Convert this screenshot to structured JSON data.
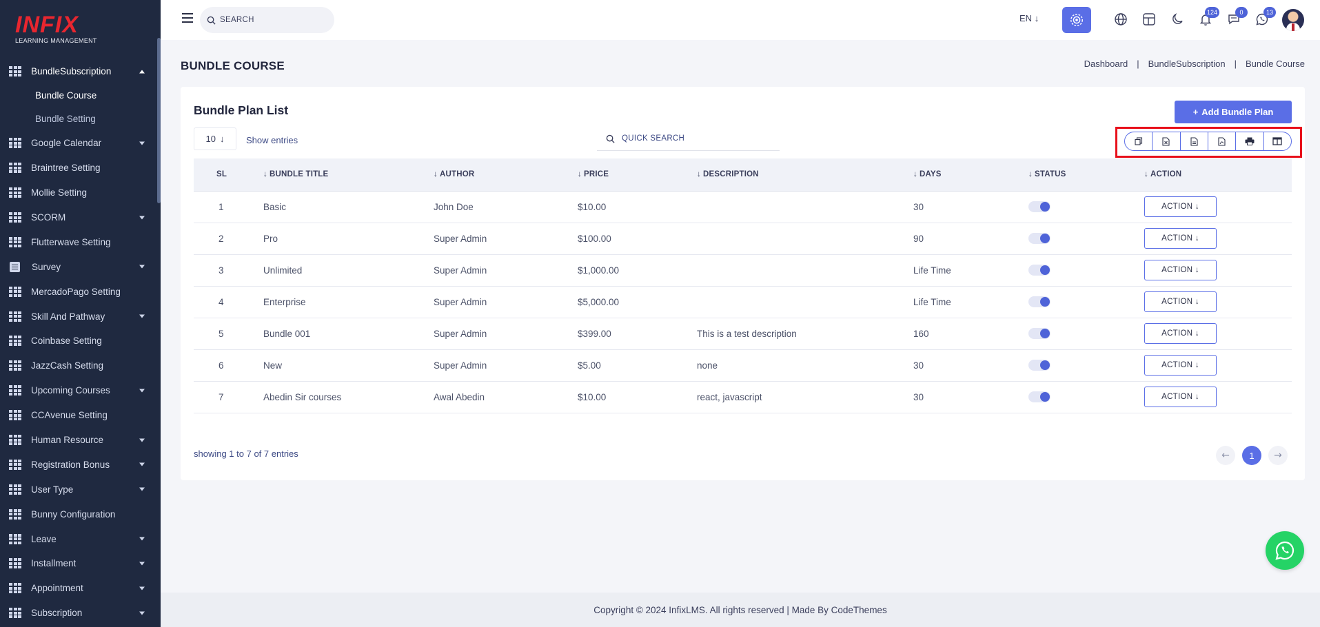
{
  "sidebar": {
    "logo_text": "INFIX",
    "logo_sub": "LEARNING MANAGEMENT",
    "active_group": "BundleSubscription",
    "sub_items": [
      {
        "label": "Bundle Course"
      },
      {
        "label": "Bundle Setting"
      }
    ],
    "items": [
      {
        "label": "Google Calendar",
        "expandable": true
      },
      {
        "label": "Braintree Setting",
        "expandable": false
      },
      {
        "label": "Mollie Setting",
        "expandable": false
      },
      {
        "label": "SCORM",
        "expandable": true
      },
      {
        "label": "Flutterwave Setting",
        "expandable": false
      },
      {
        "label": "Survey",
        "expandable": true
      },
      {
        "label": "MercadoPago Setting",
        "expandable": false
      },
      {
        "label": "Skill And Pathway",
        "expandable": true
      },
      {
        "label": "Coinbase Setting",
        "expandable": false
      },
      {
        "label": "JazzCash Setting",
        "expandable": false
      },
      {
        "label": "Upcoming Courses",
        "expandable": true
      },
      {
        "label": "CCAvenue Setting",
        "expandable": false
      },
      {
        "label": "Human Resource",
        "expandable": true
      },
      {
        "label": "Registration Bonus",
        "expandable": true
      },
      {
        "label": "User Type",
        "expandable": true
      },
      {
        "label": "Bunny Configuration",
        "expandable": false
      },
      {
        "label": "Leave",
        "expandable": true
      },
      {
        "label": "Installment",
        "expandable": true
      },
      {
        "label": "Appointment",
        "expandable": true
      },
      {
        "label": "Subscription",
        "expandable": true
      }
    ]
  },
  "topbar": {
    "search_placeholder": "SEARCH",
    "language": "EN",
    "badges": {
      "notifications": "124",
      "messages": "0",
      "whatsapp": "13"
    }
  },
  "page": {
    "title": "BUNDLE COURSE",
    "breadcrumb": [
      "Dashboard",
      "BundleSubscription",
      "Bundle Course"
    ]
  },
  "card": {
    "title": "Bundle Plan List",
    "add_button": "Add Bundle Plan",
    "entries_value": "10",
    "entries_label": "Show entries",
    "quick_search_placeholder": "QUICK SEARCH",
    "columns": [
      "SL",
      "BUNDLE TITLE",
      "AUTHOR",
      "PRICE",
      "DESCRIPTION",
      "DAYS",
      "STATUS",
      "ACTION"
    ],
    "rows": [
      {
        "sl": "1",
        "title": "Basic",
        "author": "John Doe",
        "price": "$10.00",
        "description": "",
        "days": "30",
        "status": true,
        "action": "ACTION"
      },
      {
        "sl": "2",
        "title": "Pro",
        "author": "Super Admin",
        "price": "$100.00",
        "description": "",
        "days": "90",
        "status": true,
        "action": "ACTION"
      },
      {
        "sl": "3",
        "title": "Unlimited",
        "author": "Super Admin",
        "price": "$1,000.00",
        "description": "",
        "days": "Life Time",
        "status": true,
        "action": "ACTION"
      },
      {
        "sl": "4",
        "title": "Enterprise",
        "author": "Super Admin",
        "price": "$5,000.00",
        "description": "",
        "days": "Life Time",
        "status": true,
        "action": "ACTION"
      },
      {
        "sl": "5",
        "title": "Bundle 001",
        "author": "Super Admin",
        "price": "$399.00",
        "description": "This is a test description",
        "days": "160",
        "status": true,
        "action": "ACTION"
      },
      {
        "sl": "6",
        "title": "New",
        "author": "Super Admin",
        "price": "$5.00",
        "description": "none",
        "days": "30",
        "status": true,
        "action": "ACTION"
      },
      {
        "sl": "7",
        "title": "Abedin Sir courses",
        "author": "Awal Abedin",
        "price": "$10.00",
        "description": "react, javascript",
        "days": "30",
        "status": true,
        "action": "ACTION"
      }
    ],
    "showing_text": "showing 1 to 7 of 7 entries",
    "current_page": "1"
  },
  "footer": {
    "text": "Copyright © 2024 InfixLMS. All rights reserved | Made By CodeThemes"
  },
  "colors": {
    "sidebar_bg": "#1f2940",
    "accent": "#5a6ee6",
    "highlight": "#e8101b",
    "whatsapp": "#25d366"
  }
}
